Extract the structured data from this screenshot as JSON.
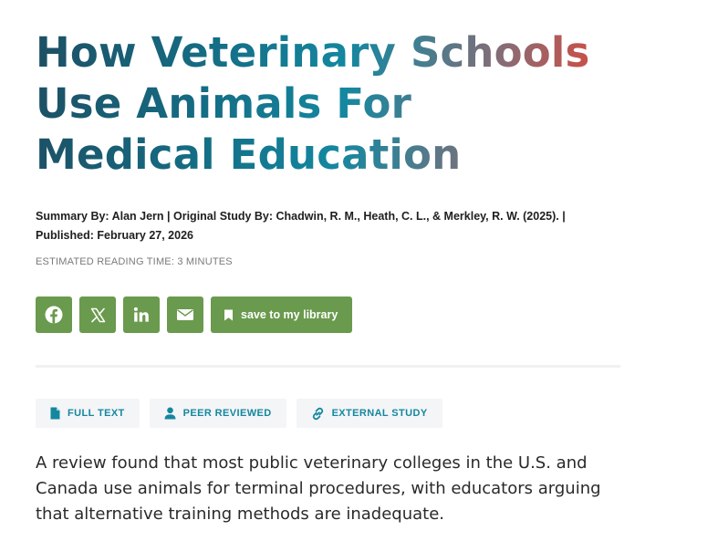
{
  "article": {
    "title_lines": [
      "How Veterinary Schools",
      "Use Animals For",
      "Medical Education"
    ],
    "byline_line1": "Summary By: Alan Jern | Original Study By: Chadwin, R. M., Heath, C. L., & Merkley, R. W. (2025). |",
    "byline_line2": "Published: February 27, 2026",
    "reading_time": "ESTIMATED READING TIME: 3 MINUTES",
    "summary": "A review found that most public veterinary colleges in the U.S. and Canada use animals for terminal procedures, with educators arguing that alternative training methods are inadequate."
  },
  "share": {
    "buttons": [
      {
        "icon": "facebook-icon"
      },
      {
        "icon": "x-twitter-icon"
      },
      {
        "icon": "linkedin-icon"
      },
      {
        "icon": "email-icon"
      }
    ],
    "library_label": "save to my library",
    "button_color": "#6a9a4d"
  },
  "tags": {
    "full_text": "FULL TEXT",
    "peer_reviewed": "PEER REVIEWED",
    "external_study": "EXTERNAL STUDY",
    "color": "#1487a0"
  },
  "colors": {
    "title_gradient_start": "#1d4f63",
    "title_gradient_mid": "#1487a0",
    "title_gradient_end": "#e04438"
  }
}
